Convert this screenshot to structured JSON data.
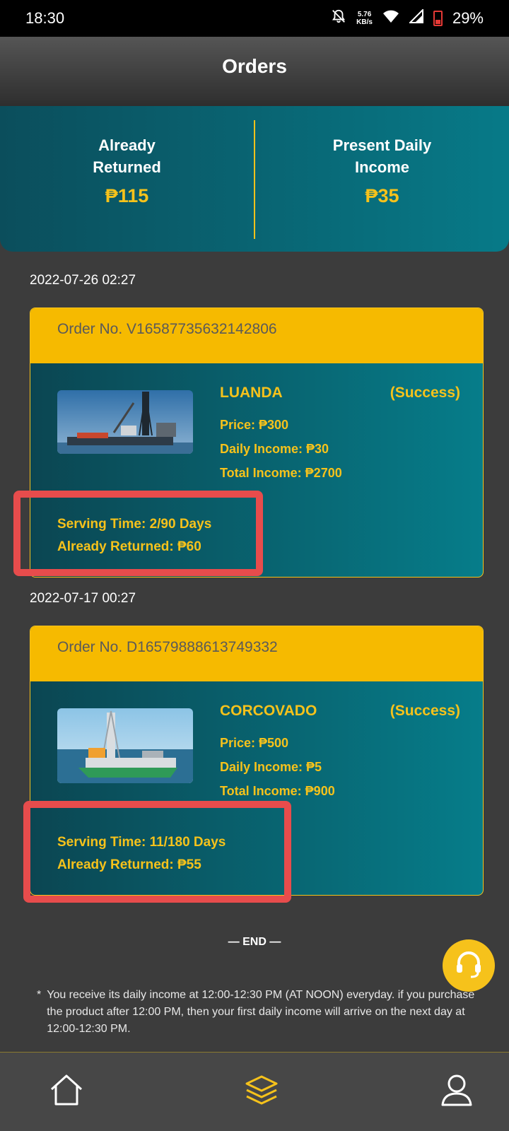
{
  "status_bar": {
    "time": "18:30",
    "net_speed_value": "5.76",
    "net_speed_unit": "KB/s",
    "battery": "29%",
    "icons": [
      "notifications-off-icon",
      "wifi-icon",
      "signal-icon",
      "battery-icon"
    ]
  },
  "header": {
    "title": "Orders"
  },
  "summary": {
    "already_returned_label": "Already Returned",
    "already_returned_value": "₱115",
    "present_daily_label": "Present Daily Income",
    "present_daily_value": "₱35"
  },
  "orders": [
    {
      "date": "2022-07-26 02:27",
      "order_no": "Order No. V16587735632142806",
      "name": "LUANDA",
      "status": "(Success)",
      "price": "Price: ₱300",
      "daily_income": "Daily Income: ₱30",
      "total_income": "Total Income: ₱2700",
      "serving_time": "Serving Time: 2/90 Days",
      "already_returned": "Already Returned: ₱60"
    },
    {
      "date": "2022-07-17 00:27",
      "order_no": "Order No. D16579888613749332",
      "name": "CORCOVADO",
      "status": "(Success)",
      "price": "Price: ₱500",
      "daily_income": "Daily Income: ₱5",
      "total_income": "Total Income: ₱900",
      "serving_time": "Serving Time: 11/180 Days",
      "already_returned": "Already Returned: ₱55"
    }
  ],
  "end_label": "— END —",
  "note": {
    "bullet": "*",
    "text": "You receive its daily income at 12:00-12:30 PM (AT NOON) everyday. if you purchase the product after 12:00 PM, then your first daily income will arrive on the next day at 12:00-12:30 PM."
  },
  "tabbar": {
    "active": "orders",
    "icons": [
      "home-icon",
      "layers-icon",
      "user-icon"
    ]
  },
  "colors": {
    "accent": "#f6c21b",
    "highlight": "#e74c4c",
    "panel_start": "#0b4e5c",
    "panel_end": "#077a88"
  }
}
